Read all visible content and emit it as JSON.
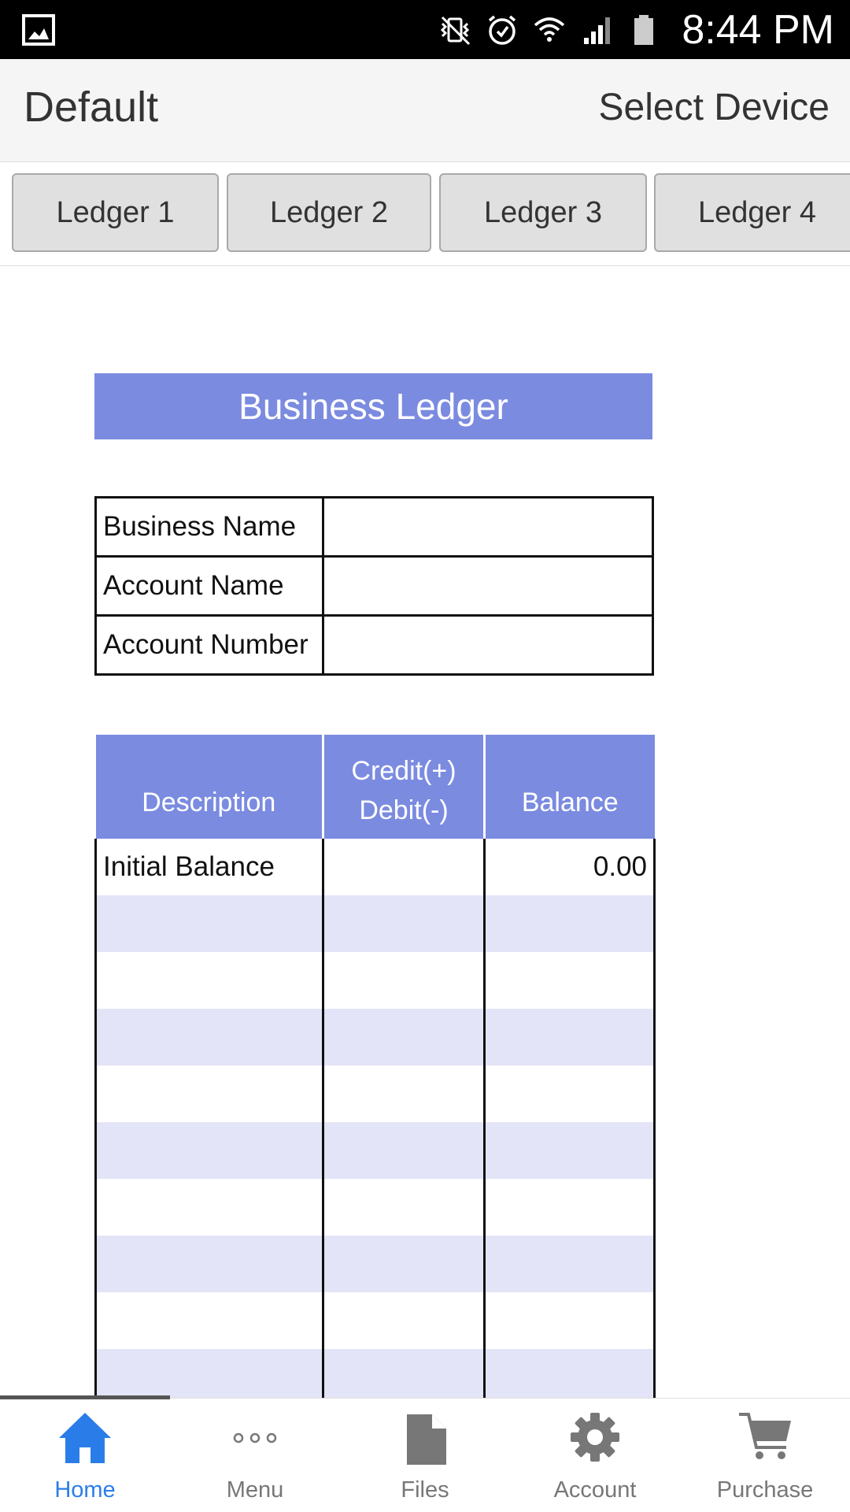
{
  "status_bar": {
    "time": "8:44 PM",
    "icons": [
      "gallery-icon",
      "vibrate-mute-icon",
      "alarm-icon",
      "wifi-icon",
      "signal-icon",
      "battery-icon"
    ]
  },
  "header": {
    "title": "Default",
    "select_device": "Select Device"
  },
  "tabs": [
    {
      "label": "Ledger 1"
    },
    {
      "label": "Ledger 2"
    },
    {
      "label": "Ledger 3"
    },
    {
      "label": "Ledger 4"
    }
  ],
  "ledger": {
    "title": "Business Ledger",
    "info": [
      {
        "label": "Business Name",
        "value": ""
      },
      {
        "label": "Account Name",
        "value": ""
      },
      {
        "label": "Account Number",
        "value": ""
      }
    ],
    "columns": {
      "description": "Description",
      "credit": "Credit(+)",
      "debit": "Debit(-)",
      "balance": "Balance"
    },
    "rows": [
      {
        "description": "Initial Balance",
        "credit_debit": "",
        "balance": "0.00"
      },
      {
        "description": "",
        "credit_debit": "",
        "balance": ""
      },
      {
        "description": "",
        "credit_debit": "",
        "balance": ""
      },
      {
        "description": "",
        "credit_debit": "",
        "balance": ""
      },
      {
        "description": "",
        "credit_debit": "",
        "balance": ""
      },
      {
        "description": "",
        "credit_debit": "",
        "balance": ""
      },
      {
        "description": "",
        "credit_debit": "",
        "balance": ""
      },
      {
        "description": "",
        "credit_debit": "",
        "balance": ""
      },
      {
        "description": "",
        "credit_debit": "",
        "balance": ""
      },
      {
        "description": "",
        "credit_debit": "",
        "balance": ""
      }
    ]
  },
  "bottom_nav": [
    {
      "label": "Home",
      "icon": "home-icon",
      "active": true
    },
    {
      "label": "Menu",
      "icon": "more-icon",
      "active": false
    },
    {
      "label": "Files",
      "icon": "file-icon",
      "active": false
    },
    {
      "label": "Account",
      "icon": "gear-icon",
      "active": false
    },
    {
      "label": "Purchase",
      "icon": "cart-icon",
      "active": false
    }
  ],
  "colors": {
    "accent": "#7b8be0",
    "row_alt": "#e3e4f7",
    "nav_active": "#2a7de8",
    "nav_inactive": "#777777"
  }
}
